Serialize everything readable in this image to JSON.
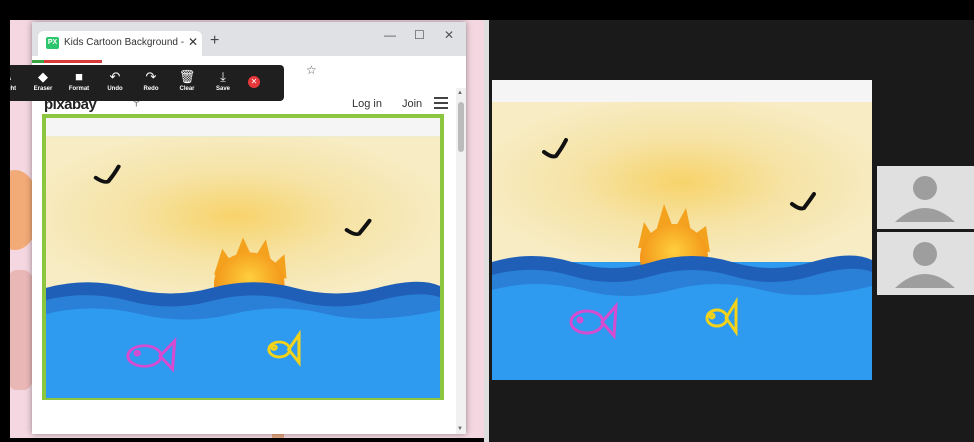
{
  "browser": {
    "tab_title": "Kids Cartoon Background - Free",
    "tab_favicon": "PX",
    "tab_close": "✕",
    "new_tab": "+",
    "minimize": "—",
    "maximize": "☐",
    "close": "✕",
    "star_icon": "☆"
  },
  "annotation_toolbar": {
    "tools": [
      {
        "label": "otlight",
        "icon": "✎"
      },
      {
        "label": "Eraser",
        "icon": "◆"
      },
      {
        "label": "Format",
        "icon": "■"
      },
      {
        "label": "Undo",
        "icon": "↶"
      },
      {
        "label": "Redo",
        "icon": "↷"
      },
      {
        "label": "Clear",
        "icon": "🗑"
      },
      {
        "label": "Save",
        "icon": "⤓"
      }
    ],
    "close_icon": "✕"
  },
  "site": {
    "logo": "pixabay",
    "search_icon": "⚲",
    "login": "Log in",
    "join": "Join"
  },
  "colors": {
    "border_green": "#8cc63f",
    "sky": "#f7e6a8",
    "sun": "#f4a21e",
    "water": "#2e9bf0",
    "wave_dark": "#1f5fb8",
    "fish_pink": "#d64bd0",
    "fish_yellow": "#f2d21a"
  }
}
